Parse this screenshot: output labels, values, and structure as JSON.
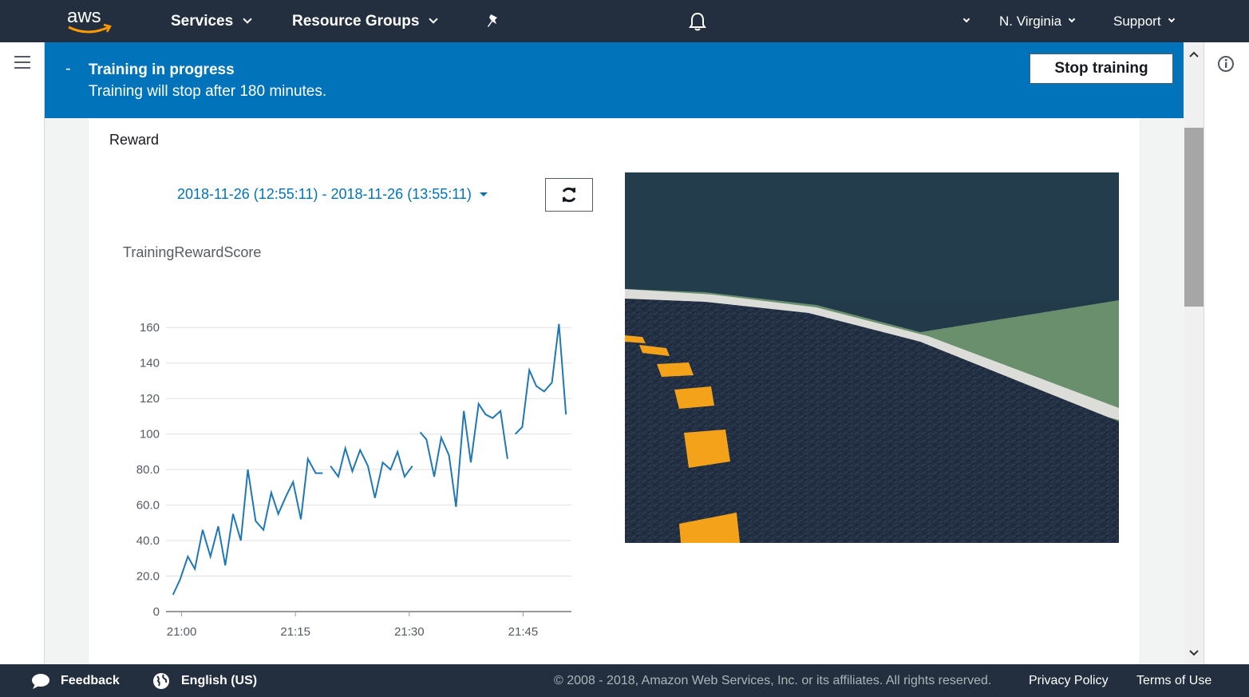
{
  "nav": {
    "logo_text": "aws",
    "services": "Services",
    "resource_groups": "Resource Groups",
    "region": "N. Virginia",
    "support": "Support"
  },
  "banner": {
    "dash": "-",
    "title": "Training in progress",
    "subtitle": "Training will stop after 180 minutes.",
    "stop_button": "Stop training"
  },
  "reward": {
    "title": "Reward",
    "date_range": "2018-11-26 (12:55:11) - 2018-11-26 (13:55:11)",
    "metric_title": "TrainingRewardScore"
  },
  "chart_data": {
    "type": "line",
    "title": "TrainingRewardScore",
    "xlabel": "",
    "ylabel": "",
    "ylim": [
      0,
      170
    ],
    "yticks": [
      "0",
      "20.0",
      "40.0",
      "60.0",
      "80.0",
      "100",
      "120",
      "140",
      "160"
    ],
    "xticks": [
      "21:00",
      "21:15",
      "21:30",
      "21:45"
    ],
    "color": "#1f77b4",
    "grid": true,
    "series": [
      {
        "segments": [
          [
            [
              20.9,
              9.5
            ],
            [
              21.8,
              18
            ],
            [
              22.8,
              31
            ],
            [
              23.7,
              24
            ],
            [
              24.7,
              46
            ],
            [
              25.7,
              31
            ],
            [
              26.7,
              48
            ],
            [
              27.6,
              26
            ],
            [
              28.6,
              55
            ],
            [
              29.6,
              40
            ],
            [
              30.5,
              80
            ],
            [
              31.5,
              51
            ],
            [
              32.5,
              46
            ],
            [
              33.5,
              67
            ],
            [
              34.4,
              55
            ],
            [
              35.4,
              65
            ],
            [
              36.3,
              73
            ],
            [
              37.3,
              52
            ],
            [
              38.2,
              86
            ],
            [
              39.2,
              78
            ],
            [
              40.1,
              78
            ]
          ],
          [
            [
              41.1,
              82
            ],
            [
              42.1,
              76
            ],
            [
              43.0,
              92
            ],
            [
              43.9,
              79
            ],
            [
              44.9,
              91
            ],
            [
              45.9,
              82
            ],
            [
              46.8,
              64
            ],
            [
              47.8,
              84
            ],
            [
              48.8,
              80
            ],
            [
              49.7,
              90
            ],
            [
              50.6,
              76
            ],
            [
              51.6,
              82
            ]
          ],
          [
            [
              52.6,
              101
            ],
            [
              53.4,
              97
            ],
            [
              54.4,
              76
            ],
            [
              55.3,
              98
            ],
            [
              56.3,
              88
            ],
            [
              57.2,
              59
            ],
            [
              58.2,
              113
            ],
            [
              59.1,
              84
            ],
            [
              60.1,
              117
            ],
            [
              61.0,
              111
            ],
            [
              61.9,
              109
            ],
            [
              62.9,
              113
            ],
            [
              63.8,
              86
            ]
          ],
          [
            [
              64.8,
              100
            ],
            [
              65.7,
              104
            ],
            [
              66.6,
              136
            ],
            [
              67.5,
              127
            ],
            [
              68.5,
              124
            ],
            [
              69.5,
              129
            ],
            [
              70.4,
              162
            ],
            [
              71.3,
              111
            ]
          ]
        ]
      }
    ]
  },
  "footer": {
    "feedback": "Feedback",
    "language": "English (US)",
    "copyright": "© 2008 - 2018, Amazon Web Services, Inc. or its affiliates. All rights reserved.",
    "privacy": "Privacy Policy",
    "terms": "Terms of Use"
  }
}
